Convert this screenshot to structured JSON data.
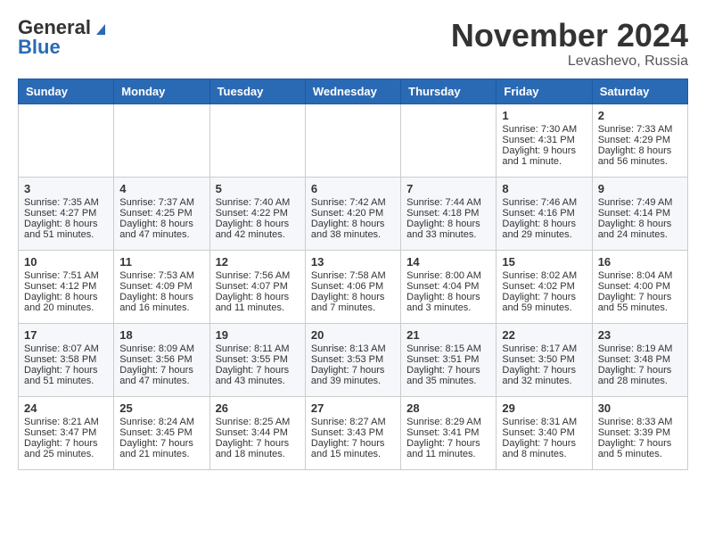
{
  "header": {
    "logo_general": "General",
    "logo_blue": "Blue",
    "month_title": "November 2024",
    "location": "Levashevo, Russia"
  },
  "days_of_week": [
    "Sunday",
    "Monday",
    "Tuesday",
    "Wednesday",
    "Thursday",
    "Friday",
    "Saturday"
  ],
  "weeks": [
    [
      {
        "day": "",
        "info": ""
      },
      {
        "day": "",
        "info": ""
      },
      {
        "day": "",
        "info": ""
      },
      {
        "day": "",
        "info": ""
      },
      {
        "day": "",
        "info": ""
      },
      {
        "day": "1",
        "info": "Sunrise: 7:30 AM\nSunset: 4:31 PM\nDaylight: 9 hours and 1 minute."
      },
      {
        "day": "2",
        "info": "Sunrise: 7:33 AM\nSunset: 4:29 PM\nDaylight: 8 hours and 56 minutes."
      }
    ],
    [
      {
        "day": "3",
        "info": "Sunrise: 7:35 AM\nSunset: 4:27 PM\nDaylight: 8 hours and 51 minutes."
      },
      {
        "day": "4",
        "info": "Sunrise: 7:37 AM\nSunset: 4:25 PM\nDaylight: 8 hours and 47 minutes."
      },
      {
        "day": "5",
        "info": "Sunrise: 7:40 AM\nSunset: 4:22 PM\nDaylight: 8 hours and 42 minutes."
      },
      {
        "day": "6",
        "info": "Sunrise: 7:42 AM\nSunset: 4:20 PM\nDaylight: 8 hours and 38 minutes."
      },
      {
        "day": "7",
        "info": "Sunrise: 7:44 AM\nSunset: 4:18 PM\nDaylight: 8 hours and 33 minutes."
      },
      {
        "day": "8",
        "info": "Sunrise: 7:46 AM\nSunset: 4:16 PM\nDaylight: 8 hours and 29 minutes."
      },
      {
        "day": "9",
        "info": "Sunrise: 7:49 AM\nSunset: 4:14 PM\nDaylight: 8 hours and 24 minutes."
      }
    ],
    [
      {
        "day": "10",
        "info": "Sunrise: 7:51 AM\nSunset: 4:12 PM\nDaylight: 8 hours and 20 minutes."
      },
      {
        "day": "11",
        "info": "Sunrise: 7:53 AM\nSunset: 4:09 PM\nDaylight: 8 hours and 16 minutes."
      },
      {
        "day": "12",
        "info": "Sunrise: 7:56 AM\nSunset: 4:07 PM\nDaylight: 8 hours and 11 minutes."
      },
      {
        "day": "13",
        "info": "Sunrise: 7:58 AM\nSunset: 4:06 PM\nDaylight: 8 hours and 7 minutes."
      },
      {
        "day": "14",
        "info": "Sunrise: 8:00 AM\nSunset: 4:04 PM\nDaylight: 8 hours and 3 minutes."
      },
      {
        "day": "15",
        "info": "Sunrise: 8:02 AM\nSunset: 4:02 PM\nDaylight: 7 hours and 59 minutes."
      },
      {
        "day": "16",
        "info": "Sunrise: 8:04 AM\nSunset: 4:00 PM\nDaylight: 7 hours and 55 minutes."
      }
    ],
    [
      {
        "day": "17",
        "info": "Sunrise: 8:07 AM\nSunset: 3:58 PM\nDaylight: 7 hours and 51 minutes."
      },
      {
        "day": "18",
        "info": "Sunrise: 8:09 AM\nSunset: 3:56 PM\nDaylight: 7 hours and 47 minutes."
      },
      {
        "day": "19",
        "info": "Sunrise: 8:11 AM\nSunset: 3:55 PM\nDaylight: 7 hours and 43 minutes."
      },
      {
        "day": "20",
        "info": "Sunrise: 8:13 AM\nSunset: 3:53 PM\nDaylight: 7 hours and 39 minutes."
      },
      {
        "day": "21",
        "info": "Sunrise: 8:15 AM\nSunset: 3:51 PM\nDaylight: 7 hours and 35 minutes."
      },
      {
        "day": "22",
        "info": "Sunrise: 8:17 AM\nSunset: 3:50 PM\nDaylight: 7 hours and 32 minutes."
      },
      {
        "day": "23",
        "info": "Sunrise: 8:19 AM\nSunset: 3:48 PM\nDaylight: 7 hours and 28 minutes."
      }
    ],
    [
      {
        "day": "24",
        "info": "Sunrise: 8:21 AM\nSunset: 3:47 PM\nDaylight: 7 hours and 25 minutes."
      },
      {
        "day": "25",
        "info": "Sunrise: 8:24 AM\nSunset: 3:45 PM\nDaylight: 7 hours and 21 minutes."
      },
      {
        "day": "26",
        "info": "Sunrise: 8:25 AM\nSunset: 3:44 PM\nDaylight: 7 hours and 18 minutes."
      },
      {
        "day": "27",
        "info": "Sunrise: 8:27 AM\nSunset: 3:43 PM\nDaylight: 7 hours and 15 minutes."
      },
      {
        "day": "28",
        "info": "Sunrise: 8:29 AM\nSunset: 3:41 PM\nDaylight: 7 hours and 11 minutes."
      },
      {
        "day": "29",
        "info": "Sunrise: 8:31 AM\nSunset: 3:40 PM\nDaylight: 7 hours and 8 minutes."
      },
      {
        "day": "30",
        "info": "Sunrise: 8:33 AM\nSunset: 3:39 PM\nDaylight: 7 hours and 5 minutes."
      }
    ]
  ]
}
